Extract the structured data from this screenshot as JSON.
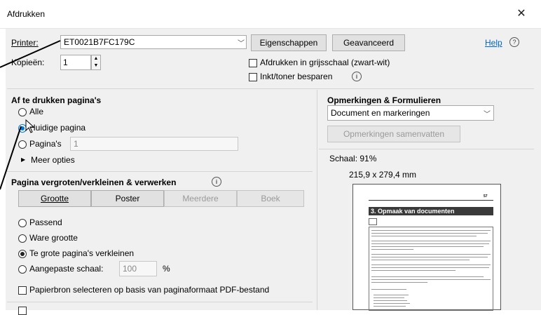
{
  "window": {
    "title": "Afdrukken",
    "close_glyph": "✕"
  },
  "printer": {
    "label": "Printer:",
    "value": "ET0021B7FC179C",
    "properties_button": "Eigenschappen",
    "advanced_button": "Geavanceerd",
    "help_link": "Help",
    "help_icon_glyph": "?"
  },
  "copies": {
    "label": "Kopieën:",
    "value": "1"
  },
  "options": {
    "grayscale_label": "Afdrukken in grijsschaal (zwart-wit)",
    "save_ink_label": "Inkt/toner besparen",
    "info_glyph": "i"
  },
  "pages": {
    "title": "Af te drukken pagina's",
    "all": "Alle",
    "current": "Huidige pagina",
    "pages": "Pagina's",
    "pages_value": "1",
    "more": "Meer opties",
    "more_glyph": "▶"
  },
  "sizing": {
    "title": "Pagina vergroten/verkleinen & verwerken",
    "info_glyph": "i",
    "tabs": [
      "Grootte",
      "Poster",
      "Meerdere",
      "Boek"
    ],
    "fit": "Passend",
    "actual": "Ware grootte",
    "shrink": "Te grote pagina's verkleinen",
    "custom": "Aangepaste schaal:",
    "custom_value": "100",
    "percent": "%",
    "paper_source": "Papierbron selecteren op basis van paginaformaat PDF-bestand"
  },
  "comments": {
    "title": "Opmerkingen & Formulieren",
    "select_value": "Document en markeringen",
    "summarize_button": "Opmerkingen samenvatten"
  },
  "preview": {
    "scale_label": "Schaal:",
    "scale_value": "91%",
    "dimensions": "215,9 x 279,4 mm",
    "page_number": "57",
    "heading": "3. Opmaak van documenten"
  },
  "colors": {
    "dialog_bg": "#f0f0f0",
    "link": "#0066cc",
    "accent_radio": "#0078d7"
  }
}
